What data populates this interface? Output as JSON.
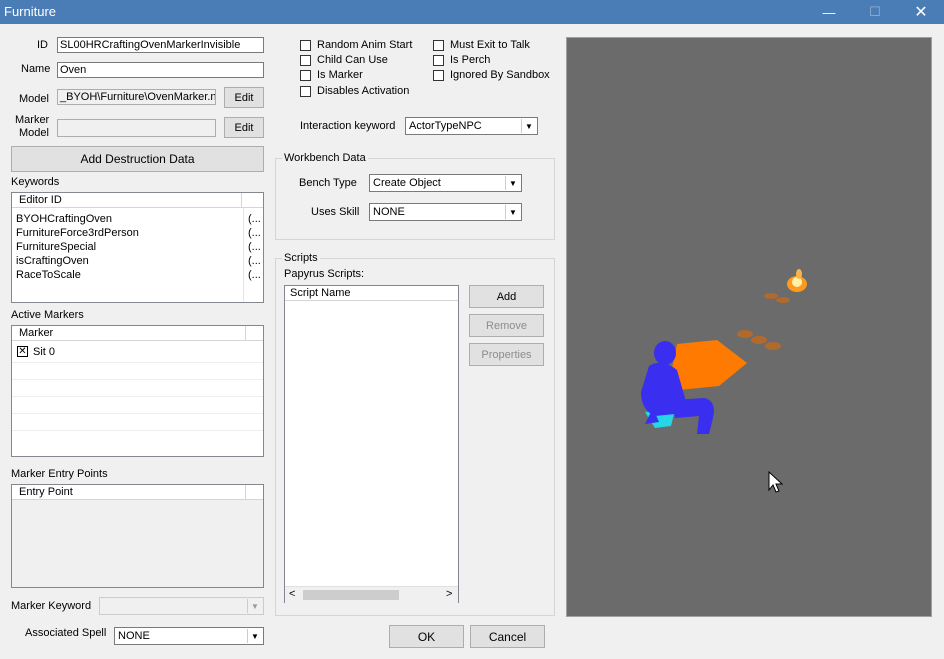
{
  "window": {
    "title": "Furniture",
    "minimize_glyph": "—",
    "maximize_glyph": "☐",
    "close_glyph": "✕"
  },
  "left": {
    "id_label": "ID",
    "id_value": "SL00HRCraftingOvenMarkerInvisible",
    "name_label": "Name",
    "name_value": "Oven",
    "model_label": "Model",
    "model_value": "_BYOH\\Furniture\\OvenMarker.n",
    "model_edit": "Edit",
    "marker_model_label_1": "Marker",
    "marker_model_label_2": "Model",
    "marker_model_value": "",
    "marker_model_edit": "Edit",
    "add_destruction": "Add Destruction Data",
    "keywords_label": "Keywords",
    "keywords_col": "Editor ID",
    "keywords": [
      {
        "name": "BYOHCraftingOven",
        "extra": "(..."
      },
      {
        "name": "FurnitureForce3rdPerson",
        "extra": "(..."
      },
      {
        "name": "FurnitureSpecial",
        "extra": "(..."
      },
      {
        "name": "isCraftingOven",
        "extra": "(..."
      },
      {
        "name": "RaceToScale",
        "extra": "(..."
      }
    ],
    "active_markers_label": "Active Markers",
    "markers_col": "Marker",
    "markers": [
      {
        "name": "Sit 0",
        "checked": true
      }
    ],
    "entry_points_label": "Marker Entry Points",
    "entry_col": "Entry Point",
    "marker_keyword_label": "Marker Keyword",
    "marker_keyword_value": "",
    "assoc_spell_label": "Associated Spell",
    "assoc_spell_value": "NONE"
  },
  "flags": [
    {
      "label": "Random Anim Start",
      "checked": false
    },
    {
      "label": "Child Can Use",
      "checked": false
    },
    {
      "label": "Is Marker",
      "checked": false
    },
    {
      "label": "Disables Activation",
      "checked": false
    },
    {
      "label": "Must Exit to Talk",
      "checked": false
    },
    {
      "label": "Is Perch",
      "checked": false
    },
    {
      "label": "Ignored By Sandbox",
      "checked": false
    }
  ],
  "interaction": {
    "label": "Interaction keyword",
    "value": "ActorTypeNPC"
  },
  "workbench": {
    "title": "Workbench Data",
    "bench_type_label": "Bench Type",
    "bench_type_value": "Create Object",
    "uses_skill_label": "Uses Skill",
    "uses_skill_value": "NONE"
  },
  "scripts": {
    "title": "Scripts",
    "papyrus_label": "Papyrus Scripts:",
    "col": "Script Name",
    "add": "Add",
    "remove": "Remove",
    "properties": "Properties"
  },
  "footer": {
    "ok": "OK",
    "cancel": "Cancel"
  },
  "preview": {
    "background_color": "#6b6b6b",
    "figure_color": "#3a2ef0",
    "platform_color": "#ff7a00",
    "marker_color": "#24d6e6"
  }
}
